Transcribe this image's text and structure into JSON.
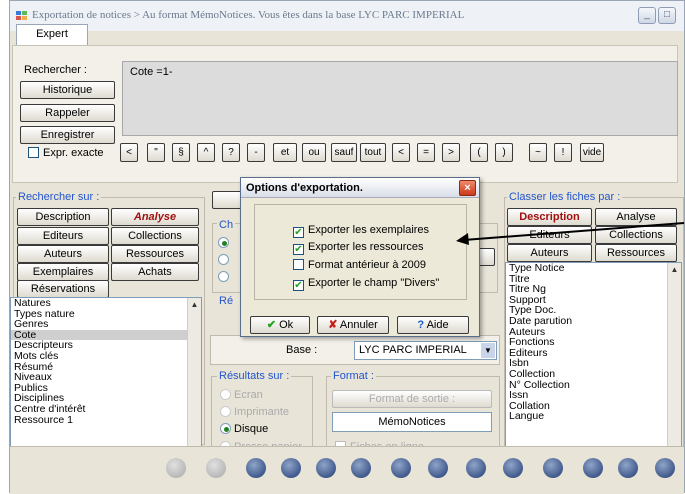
{
  "window": {
    "title": "Exportation de notices > Au format MémoNotices. Vous êtes dans la base LYC PARC IMPERIAL",
    "minimize_glyph": "_",
    "maximize_glyph": "□",
    "close_glyph": "×"
  },
  "tabs": [
    {
      "label": "Expert"
    }
  ],
  "search": {
    "label": "Rechercher :",
    "query": "Cote =1-",
    "buttons": [
      "Historique",
      "Rappeler",
      "Enregistrer"
    ],
    "expr_exacte": "Expr. exacte",
    "symbols": [
      "<",
      "\"",
      "§",
      "^",
      "?",
      "-",
      "et",
      "ou",
      "sauf",
      "tout",
      "<",
      "=",
      ">",
      "(",
      ")",
      "~",
      "!",
      "vide"
    ]
  },
  "rechercher_sur": {
    "label": "Rechercher sur :",
    "buttons": [
      "Description",
      "Analyse",
      "Editeurs",
      "Collections",
      "Auteurs",
      "Ressources",
      "Exemplaires",
      "Achats",
      "Réservations"
    ],
    "fields": [
      "Natures",
      "Types nature",
      "Genres",
      "Cote",
      "Descripteurs",
      "Mots clés",
      "Résumé",
      "Niveaux",
      "Publics",
      "Disciplines",
      "Centre d'intérêt",
      "Ressource 1"
    ],
    "selected": "Cote"
  },
  "middle": {
    "ch_label": "Ch",
    "re_label": "Ré",
    "base_label": "Base :",
    "base_value": "LYC PARC IMPERIAL",
    "resultats_label": "Résultats sur :",
    "resultats": [
      "Ecran",
      "Imprimante",
      "Disque",
      "Presse papier"
    ],
    "format_label": "Format :",
    "format_button": "Format de sortie :",
    "format_value": "MémoNotices",
    "fiches_en_ligne": "Fiches en ligne"
  },
  "classer": {
    "label": "Classer les fiches par :",
    "buttons": [
      "Description",
      "Analyse",
      "Editeurs",
      "Collections",
      "Auteurs",
      "Ressources"
    ],
    "fields": [
      "Type Notice",
      "Titre",
      "Titre Ng",
      "Support",
      "Type Doc.",
      "Date parution",
      "Auteurs",
      "Fonctions",
      "Editeurs",
      "Isbn",
      "Collection",
      "N° Collection",
      "Issn",
      "Collation",
      "Langue"
    ]
  },
  "dialog": {
    "title": "Options d'exportation.",
    "options": [
      {
        "label": "Exporter les exemplaires",
        "checked": true
      },
      {
        "label": "Exporter les ressources",
        "checked": true
      },
      {
        "label": "Format antérieur à 2009",
        "checked": false
      },
      {
        "label": "Exporter le champ \"Divers\"",
        "checked": true
      }
    ],
    "ok": "Ok",
    "annuler": "Annuler",
    "aide": "Aide",
    "ok_glyph": "✔",
    "annuler_glyph": "✘",
    "aide_glyph": "?"
  },
  "checkmark_glyph": "✔",
  "colors": {
    "accent_blue": "#1a3ea8",
    "accent_red": "#a01010",
    "group_label": "#2255cc"
  }
}
